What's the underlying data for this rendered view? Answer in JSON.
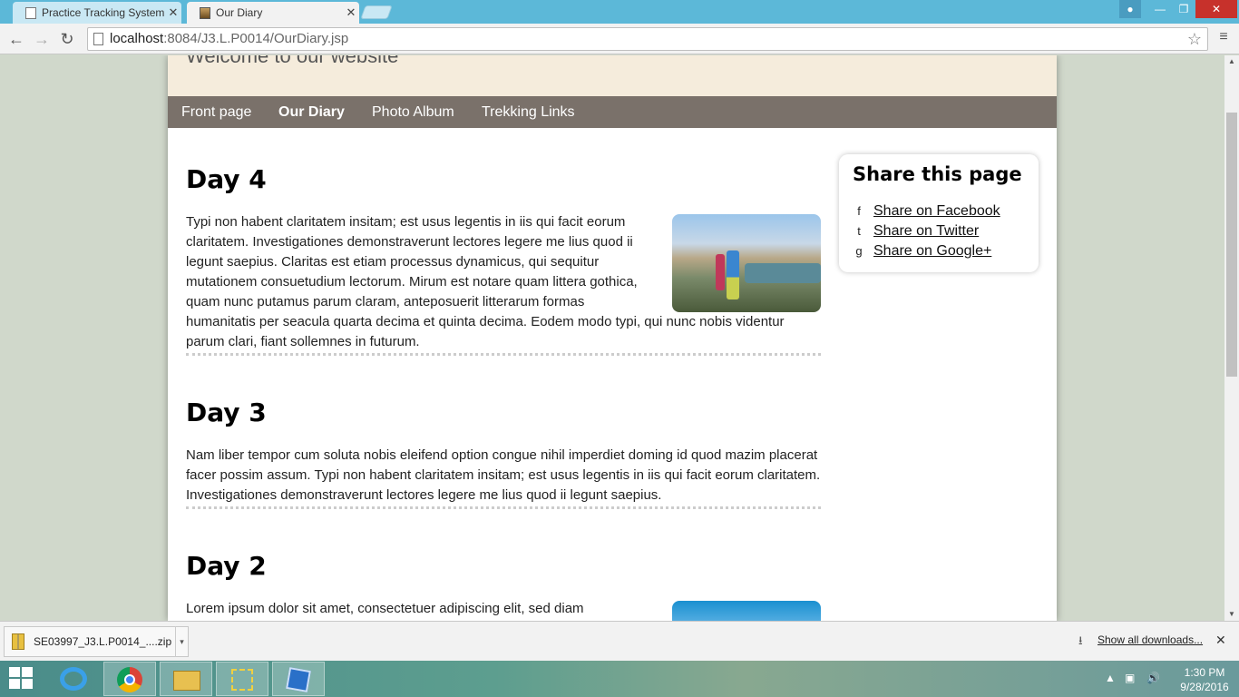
{
  "browser": {
    "tabs": [
      {
        "title": "Practice Tracking System",
        "active": false
      },
      {
        "title": "Our Diary",
        "active": true
      }
    ],
    "address": {
      "host": "localhost",
      "path": ":8084/J3.L.P0014/OurDiary.jsp"
    }
  },
  "site": {
    "welcome": "Welcome to our website",
    "nav": [
      "Front page",
      "Our Diary",
      "Photo Album",
      "Trekking Links"
    ],
    "current_nav": "Our Diary"
  },
  "entries": [
    {
      "title": "Day 4",
      "text": "Typi non habent claritatem insitam; est usus legentis in iis qui facit eorum claritatem. Investigationes demonstraverunt lectores legere me lius quod ii legunt saepius. Claritas est etiam processus dynamicus, qui sequitur mutationem consuetudium lectorum. Mirum est notare quam littera gothica, quam nunc putamus parum claram, anteposuerit litterarum formas humanitatis per seacula quarta decima et quinta decima. Eodem modo typi, qui nunc nobis videntur parum clari, fiant sollemnes in futurum."
    },
    {
      "title": "Day 3",
      "text": "Nam liber tempor cum soluta nobis eleifend option congue nihil imperdiet doming id quod mazim placerat facer possim assum. Typi non habent claritatem insitam; est usus legentis in iis qui facit eorum claritatem. Investigationes demonstraverunt lectores legere me lius quod ii legunt saepius."
    },
    {
      "title": "Day 2",
      "text": "Lorem ipsum dolor sit amet, consectetuer adipiscing elit, sed diam"
    }
  ],
  "share": {
    "title": "Share this page",
    "links": [
      "Share on Facebook",
      "Share on Twitter",
      "Share on Google+"
    ]
  },
  "downloads": {
    "file": "SE03997_J3.L.P0014_....zip",
    "show_all": "Show all downloads..."
  },
  "taskbar": {
    "time": "1:30 PM",
    "date": "9/28/2016"
  }
}
